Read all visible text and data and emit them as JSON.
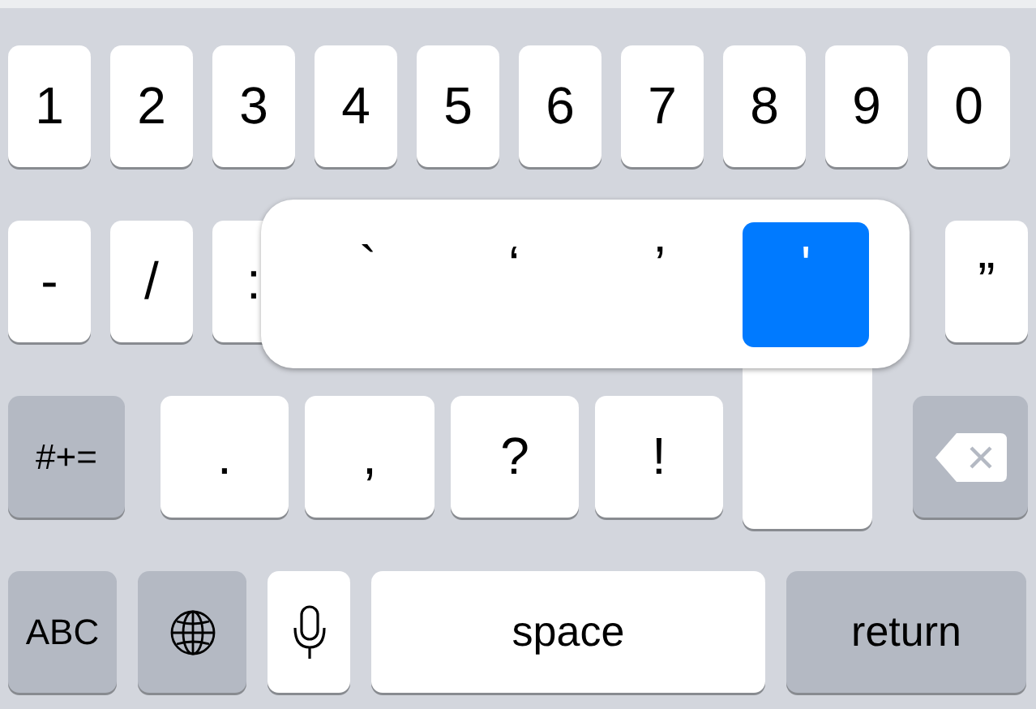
{
  "rows": [
    {
      "keys": [
        {
          "kind": "char",
          "label": "1"
        },
        {
          "kind": "char",
          "label": "2"
        },
        {
          "kind": "char",
          "label": "3"
        },
        {
          "kind": "char",
          "label": "4"
        },
        {
          "kind": "char",
          "label": "5"
        },
        {
          "kind": "char",
          "label": "6"
        },
        {
          "kind": "char",
          "label": "7"
        },
        {
          "kind": "char",
          "label": "8"
        },
        {
          "kind": "char",
          "label": "9"
        },
        {
          "kind": "char",
          "label": "0"
        }
      ]
    },
    {
      "keys": [
        {
          "kind": "char",
          "label": "-"
        },
        {
          "kind": "char",
          "label": "/"
        },
        {
          "kind": "char",
          "label": ":"
        },
        {
          "kind": "char",
          "label": "”"
        }
      ]
    },
    {
      "keys": [
        {
          "kind": "symbols",
          "label": "#+="
        },
        {
          "kind": "char",
          "label": "."
        },
        {
          "kind": "char",
          "label": ","
        },
        {
          "kind": "char",
          "label": "?"
        },
        {
          "kind": "char",
          "label": "!"
        },
        {
          "kind": "hidden"
        },
        {
          "kind": "backspace"
        }
      ]
    },
    {
      "keys": [
        {
          "kind": "abc",
          "label": "ABC"
        },
        {
          "kind": "globe"
        },
        {
          "kind": "mic"
        },
        {
          "kind": "space",
          "label": "space"
        },
        {
          "kind": "return",
          "label": "return"
        }
      ]
    }
  ],
  "popup": {
    "options": [
      {
        "label": "`",
        "selected": false
      },
      {
        "label": "‘",
        "selected": false
      },
      {
        "label": "’",
        "selected": false
      },
      {
        "label": "'",
        "selected": true
      }
    ]
  }
}
